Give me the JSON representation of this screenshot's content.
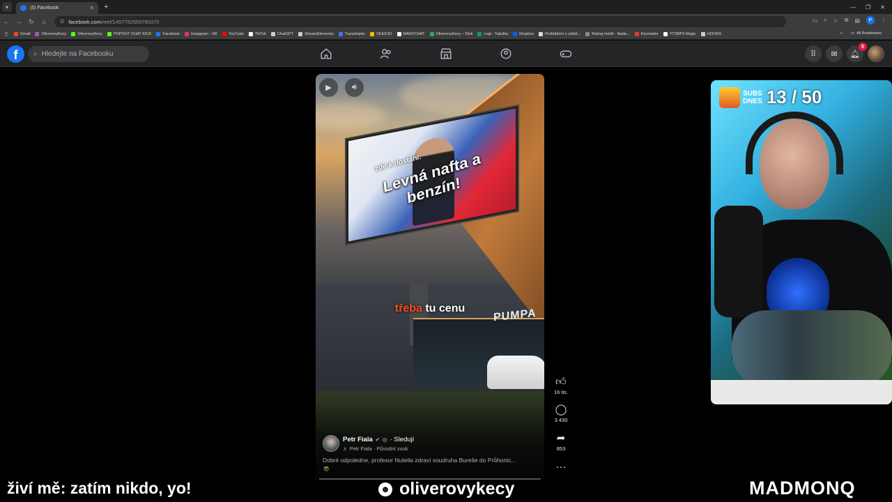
{
  "browser": {
    "tab_title": "(5) Facebook",
    "url_host": "facebook.com",
    "url_path": "/reel/1457752555790370",
    "bookmarks": [
      {
        "label": "Gmail",
        "color": "#ea4335"
      },
      {
        "label": "OliverovyKecy",
        "color": "#9b59b6"
      },
      {
        "label": "OliverovyKecy",
        "color": "#53fc18"
      },
      {
        "label": "POPOUT CHAT KICK",
        "color": "#53fc18"
      },
      {
        "label": "Facebook",
        "color": "#1877f2"
      },
      {
        "label": "Instagram - OK",
        "color": "#e1306c"
      },
      {
        "label": "YouTube",
        "color": "#ff0000"
      },
      {
        "label": "TikTok",
        "color": "#ffffff"
      },
      {
        "label": "ChatGPT",
        "color": "#cccccc"
      },
      {
        "label": "StreamElements",
        "color": "#cccccc"
      },
      {
        "label": "Transkriptor",
        "color": "#4a6cf7"
      },
      {
        "label": "VEEDJO",
        "color": "#f0c000"
      },
      {
        "label": "MANYCHAT",
        "color": "#ffffff"
      },
      {
        "label": "OliverovyKecy – Disk",
        "color": "#34a853"
      },
      {
        "label": "Logi - Tabulka",
        "color": "#0f9d58"
      },
      {
        "label": "Dropbox",
        "color": "#0061ff"
      },
      {
        "label": "Prohlášení o volbě...",
        "color": "#dddddd"
      },
      {
        "label": "Rating médií - Nada...",
        "color": "#888888"
      },
      {
        "label": "Keymailer",
        "color": "#e53935"
      },
      {
        "label": "YT2MP3 Magic",
        "color": "#ffffff"
      },
      {
        "label": "HOOKS",
        "color": "#cccccc"
      }
    ],
    "all_bookmarks": "All Bookmarks",
    "profile_initial": "P"
  },
  "facebook": {
    "search_placeholder": "Hledejte na Facebooku",
    "notifications_count": "5"
  },
  "reel": {
    "billboard_small": "zde k dostání:",
    "billboard_big": "Levná nafta a benzín!",
    "store_sign": "PUMPA",
    "caption_highlight": "třeba",
    "caption_rest": "tu cenu",
    "author_name": "Petr Fiala",
    "follow_label": "· Sledují",
    "audio_label": "♬ Petr Fiala · Původní zvuk",
    "description": "Dobré odpoledne, profesor Nutella zdraví soudruha Bureše do Průhonic...",
    "likes": "16 tis.",
    "comments": "3 430",
    "shares": "853"
  },
  "stream_overlay": {
    "subs_label_1": "SUBS",
    "subs_label_2": "DNES",
    "subs_count": "13 / 50",
    "bottom_left": "živí mě: zatím nikdo, yo!",
    "channel": "oliverovykecy",
    "brand": "MADMONQ"
  }
}
